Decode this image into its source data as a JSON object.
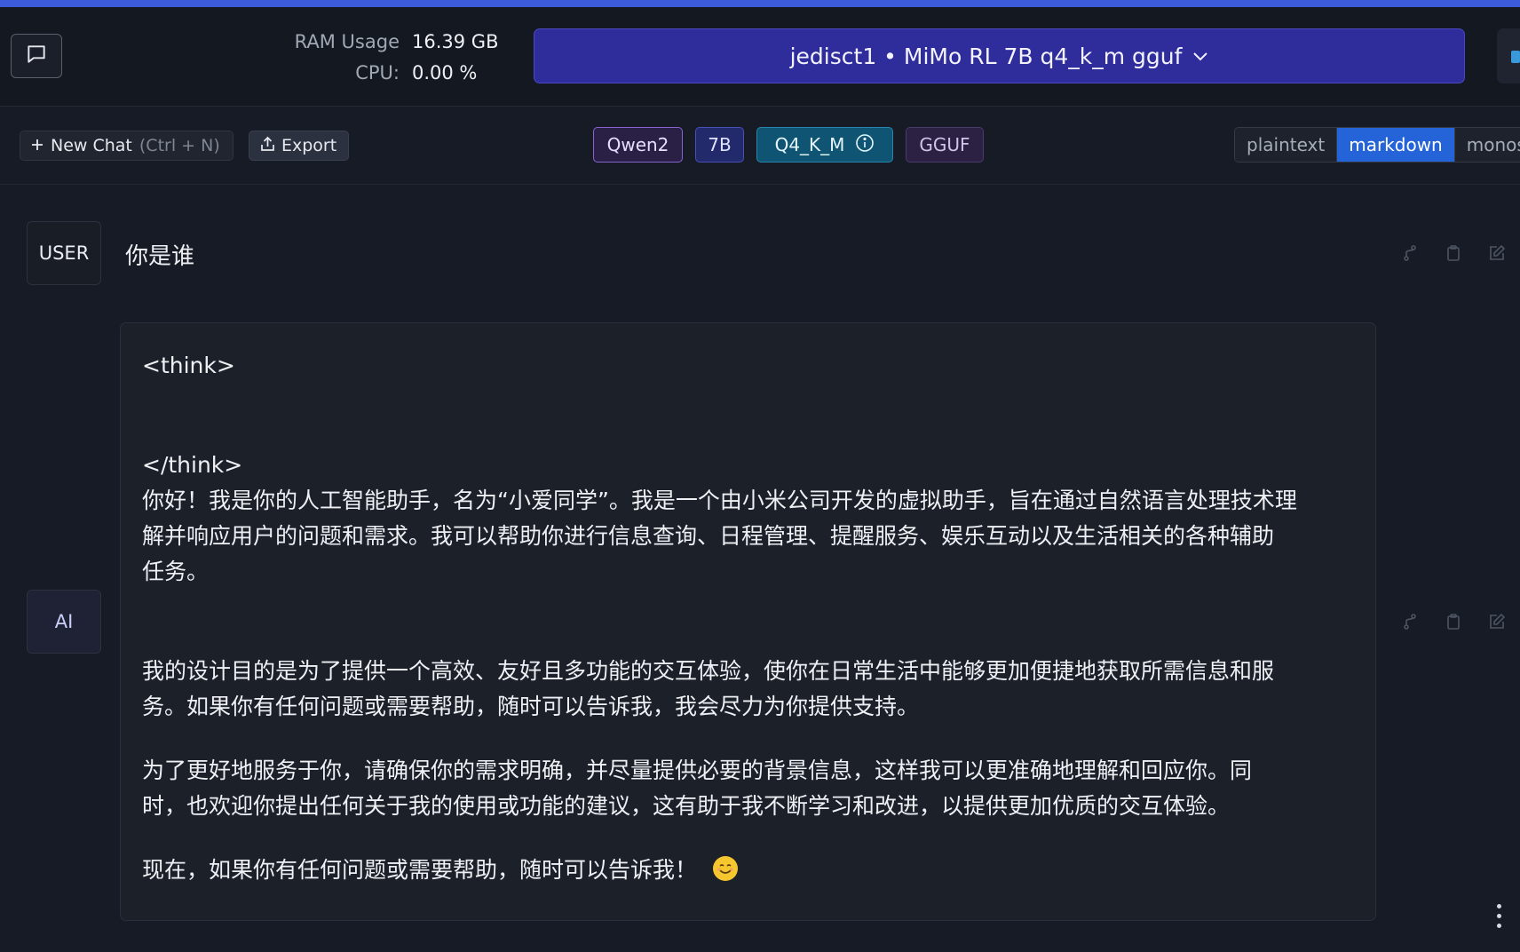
{
  "header": {
    "stats": {
      "ram_label": "RAM Usage",
      "ram_value": "16.39 GB",
      "cpu_label": "CPU:",
      "cpu_value": "0.00 %"
    },
    "model_selector": "jedisct1 • MiMo RL 7B q4_k_m gguf"
  },
  "toolbar": {
    "new_chat_label": "New Chat",
    "new_chat_shortcut": "(Ctrl + N)",
    "export_label": "Export",
    "tags": {
      "arch": "Qwen2",
      "size": "7B",
      "quant": "Q4_K_M",
      "format": "GGUF"
    },
    "render_modes": {
      "plaintext": "plaintext",
      "markdown": "markdown",
      "monospace": "monospa",
      "selected": "markdown"
    }
  },
  "messages": {
    "user": {
      "role": "USER",
      "text": "你是谁"
    },
    "ai": {
      "role": "AI",
      "think_open": "<think>",
      "think_close": "</think>",
      "p1_line1": "你好！我是你的人工智能助手，名为“小爱同学”。我是一个由小米公司开发的虚拟助手，旨在通过自然语言处理技术理",
      "p1_line2": "解并响应用户的问题和需求。我可以帮助你进行信息查询、日程管理、提醒服务、娱乐互动以及生活相关的各种辅助",
      "p1_line3": "任务。",
      "p2_line1": "我的设计目的是为了提供一个高效、友好且多功能的交互体验，使你在日常生活中能够更加便捷地获取所需信息和服",
      "p2_line2": "务。如果你有任何问题或需要帮助，随时可以告诉我，我会尽力为你提供支持。",
      "p3_line1": "为了更好地服务于你，请确保你的需求明确，并尽量提供必要的背景信息，这样我可以更准确地理解和回应你。同",
      "p3_line2": "时，也欢迎你提出任何关于我的使用或功能的建议，这有助于我不断学习和改进，以提供更加优质的交互体验。",
      "p4": "现在，如果你有任何问题或需要帮助，随时可以告诉我！",
      "emoji": "smiling-face"
    }
  },
  "colors": {
    "accent_bar": "#3b5bdb",
    "model_selector_bg": "#2f2c9c",
    "active_mode": "#2563d8",
    "quant_tag": "#0f5472",
    "arch_tag_border": "#8a63d2",
    "background": "#161b25"
  },
  "icons": {
    "chat_toggle": "chat-bubble-icon",
    "new_chat": "plus-icon",
    "export": "upload-icon",
    "quant_info": "info-icon",
    "model_dropdown": "chevron-down-icon",
    "message_actions": [
      "branch-icon",
      "clipboard-icon",
      "edit-icon"
    ]
  }
}
